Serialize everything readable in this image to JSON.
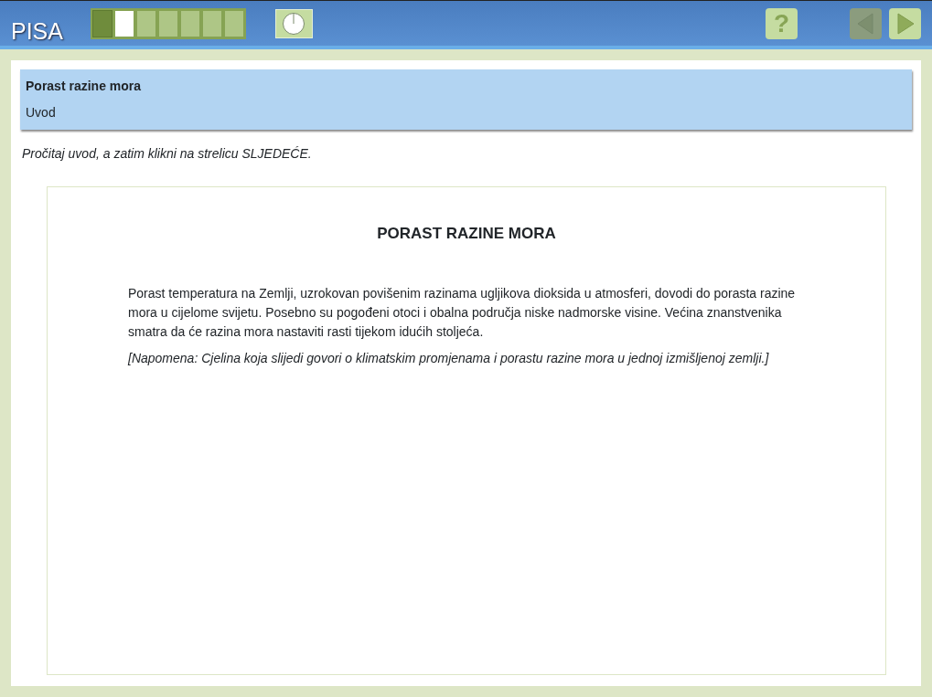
{
  "header": {
    "logo": "PISA",
    "progress": [
      {
        "completed": true,
        "selected": false
      },
      {
        "completed": false,
        "selected": true
      },
      {
        "completed": false,
        "selected": false
      },
      {
        "completed": false,
        "selected": false
      },
      {
        "completed": false,
        "selected": false
      },
      {
        "completed": false,
        "selected": false
      },
      {
        "completed": false,
        "selected": false
      }
    ],
    "help_button": {
      "label": "?"
    },
    "nav": [
      {
        "kind": "prev",
        "disabled": true
      },
      {
        "kind": "next",
        "disabled": false
      }
    ]
  },
  "unit": {
    "title": "Porast razine mora",
    "subtitle": "Uvod"
  },
  "instruction": "Pročitaj uvod, a zatim klikni na strelicu SLJEDEĆE.",
  "stimulus": {
    "title": "PORAST RAZINE MORA",
    "paragraph": "Porast temperatura na Zemlji, uzrokovan povišenim razinama ugljikova dioksida u atmosferi, dovodi do porasta razine mora u cijelome svijetu. Posebno su pogođeni otoci i obalna područja niske nadmorske visine. Većina znanstvenika smatra da će razina mora nastaviti rasti tijekom idućih stoljeća.",
    "note": "[Napomena: Cjelina koja slijedi govori o klimatskim promjenama i porastu razine mora u jednoj izmišljenoj zemlji.]"
  }
}
